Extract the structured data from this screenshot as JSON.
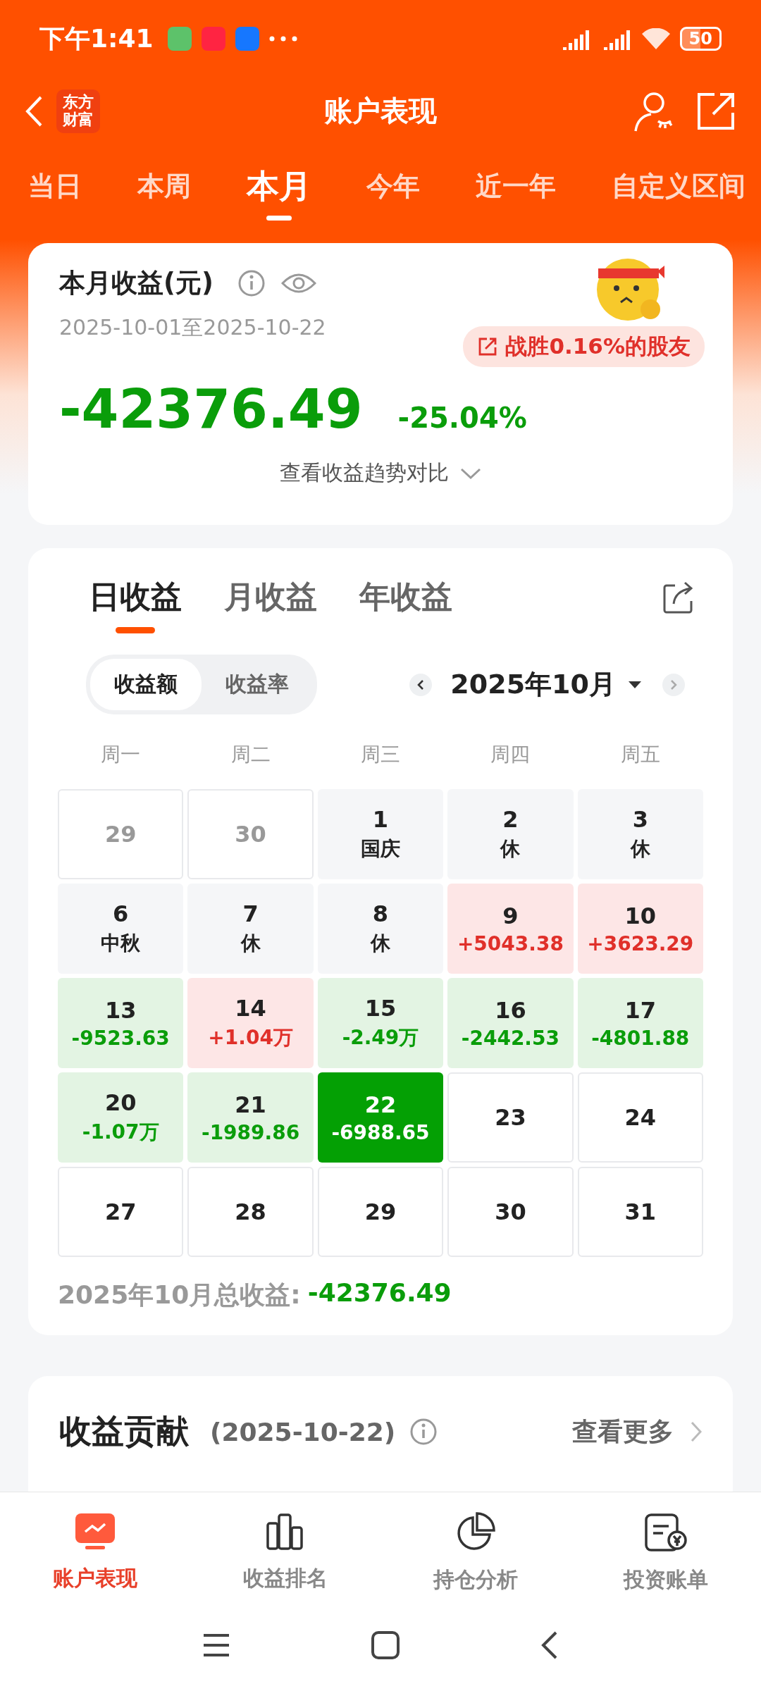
{
  "status_bar": {
    "time": "下午1:41",
    "battery": "50"
  },
  "header": {
    "logo_lines": [
      "东方",
      "财富"
    ],
    "title": "账户表现"
  },
  "period_tabs": [
    {
      "label": "当日",
      "selected": false
    },
    {
      "label": "本周",
      "selected": false
    },
    {
      "label": "本月",
      "selected": true
    },
    {
      "label": "今年",
      "selected": false
    },
    {
      "label": "近一年",
      "selected": false
    },
    {
      "label": "自定义区间",
      "selected": false
    }
  ],
  "summary": {
    "title": "本月收益(元)",
    "date_range": "2025-10-01至2025-10-22",
    "badge": "战胜0.16%的股友",
    "amount": "-42376.49",
    "percent": "-25.04%",
    "trend_link": "查看收益趋势对比"
  },
  "profit_tabs": [
    {
      "label": "日收益",
      "selected": true
    },
    {
      "label": "月收益",
      "selected": false
    },
    {
      "label": "年收益",
      "selected": false
    }
  ],
  "mode_toggle": [
    {
      "label": "收益额",
      "selected": true
    },
    {
      "label": "收益率",
      "selected": false
    }
  ],
  "month": "2025年10月",
  "weekdays": [
    "周一",
    "周二",
    "周三",
    "周四",
    "周五"
  ],
  "cells": [
    {
      "day": "29",
      "kind": "outside"
    },
    {
      "day": "30",
      "kind": "outside"
    },
    {
      "day": "1",
      "note": "国庆",
      "kind": "holiday"
    },
    {
      "day": "2",
      "note": "休",
      "kind": "holiday"
    },
    {
      "day": "3",
      "note": "休",
      "kind": "holiday"
    },
    {
      "day": "6",
      "note": "中秋",
      "kind": "holiday"
    },
    {
      "day": "7",
      "note": "休",
      "kind": "holiday"
    },
    {
      "day": "8",
      "note": "休",
      "kind": "holiday"
    },
    {
      "day": "9",
      "note": "+5043.38",
      "kind": "gain"
    },
    {
      "day": "10",
      "note": "+3623.29",
      "kind": "gain"
    },
    {
      "day": "13",
      "note": "-9523.63",
      "kind": "loss"
    },
    {
      "day": "14",
      "note": "+1.04万",
      "kind": "gain"
    },
    {
      "day": "15",
      "note": "-2.49万",
      "kind": "loss"
    },
    {
      "day": "16",
      "note": "-2442.53",
      "kind": "loss"
    },
    {
      "day": "17",
      "note": "-4801.88",
      "kind": "loss"
    },
    {
      "day": "20",
      "note": "-1.07万",
      "kind": "loss"
    },
    {
      "day": "21",
      "note": "-1989.86",
      "kind": "loss"
    },
    {
      "day": "22",
      "note": "-6988.65",
      "kind": "today"
    },
    {
      "day": "23",
      "kind": "future"
    },
    {
      "day": "24",
      "kind": "future"
    },
    {
      "day": "27",
      "kind": "future"
    },
    {
      "day": "28",
      "kind": "future"
    },
    {
      "day": "29",
      "kind": "future"
    },
    {
      "day": "30",
      "kind": "future"
    },
    {
      "day": "31",
      "kind": "future"
    }
  ],
  "month_total": {
    "label": "2025年10月总收益:",
    "value": "-42376.49"
  },
  "contribution": {
    "title": "收益贡献",
    "date": "(2025-10-22)",
    "more": "查看更多"
  },
  "bottom_nav": [
    {
      "label": "账户表现",
      "selected": true
    },
    {
      "label": "收益排名",
      "selected": false
    },
    {
      "label": "持仓分析",
      "selected": false
    },
    {
      "label": "投资账单",
      "selected": false
    }
  ]
}
